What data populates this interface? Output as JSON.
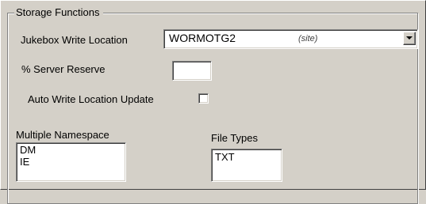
{
  "storage_functions": {
    "group_title": "Storage Functions",
    "jukebox_write_location": {
      "label": "Jukebox Write Location",
      "value": "WORMOTG2",
      "hint": "(site)"
    },
    "server_reserve": {
      "label": "% Server Reserve",
      "value": ""
    },
    "auto_write_location_update": {
      "label": "Auto Write Location Update",
      "checked": false
    },
    "multiple_namespace": {
      "label": "Multiple Namespace",
      "items": [
        "DM",
        "IE"
      ]
    },
    "file_types": {
      "label": "File Types",
      "items": [
        "TXT"
      ]
    }
  },
  "icons": {
    "dropdown": "chevron-down-icon"
  }
}
